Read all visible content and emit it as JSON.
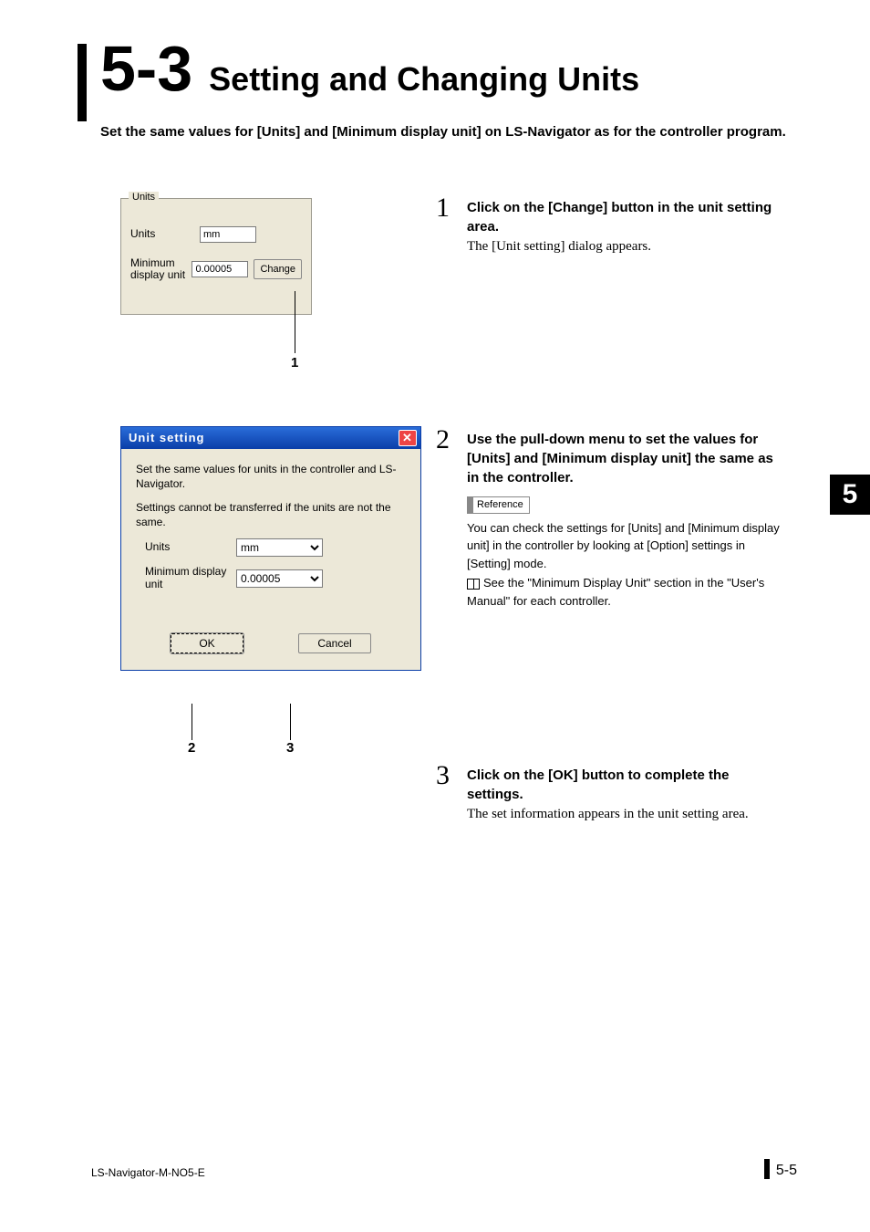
{
  "section_number": "5-3",
  "section_title": "Setting and Changing Units",
  "intro": "Set the same values for [Units] and [Minimum display unit] on LS-Navigator as for the controller program.",
  "chapter_tab": "5",
  "footer_left": "LS-Navigator-M-NO5-E",
  "footer_page": "5-5",
  "units_box": {
    "legend": "Units",
    "units_label": "Units",
    "units_value": "mm",
    "min_label": "Minimum display unit",
    "min_value": "0.00005",
    "change_btn": "Change",
    "callout": "1"
  },
  "dialog": {
    "title": "Unit setting",
    "para1": "Set the same values for units in the controller and LS-Navigator.",
    "para2": "Settings cannot be transferred if the units are not the same.",
    "units_label": "Units",
    "units_value": "mm",
    "min_label": "Minimum display unit",
    "min_value": "0.00005",
    "ok": "OK",
    "cancel": "Cancel",
    "callout_2": "2",
    "callout_3": "3"
  },
  "steps": {
    "s1": {
      "num": "1",
      "bold": "Click on the [Change] button in the unit setting area.",
      "plain": "The [Unit setting] dialog appears."
    },
    "s2": {
      "num": "2",
      "bold": "Use the pull-down menu to set the values for [Units] and [Minimum display unit] the same as in the controller.",
      "ref_label": "Reference",
      "ref_body": "You can check the settings for [Units] and [Minimum display unit] in the controller by looking at [Option] settings in [Setting] mode.",
      "book_note": "See the \"Minimum Display Unit\" section in the \"User's Manual\" for each controller."
    },
    "s3": {
      "num": "3",
      "bold": "Click on the [OK] button to complete the settings.",
      "plain": "The set information appears in the unit setting area."
    }
  }
}
